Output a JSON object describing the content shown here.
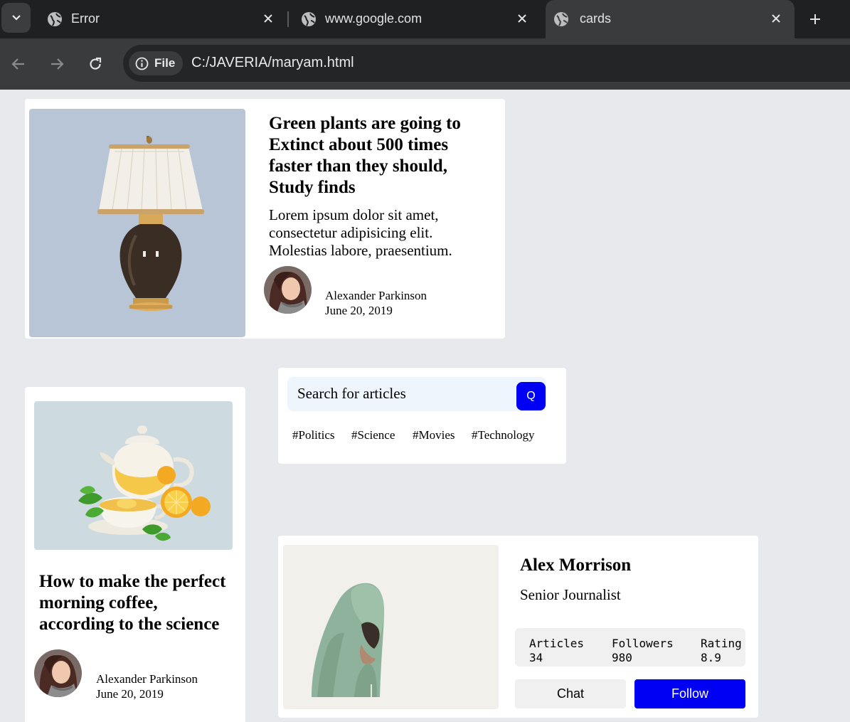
{
  "browser": {
    "tabs": [
      {
        "label": "Error",
        "active": false
      },
      {
        "label": "www.google.com",
        "active": false
      },
      {
        "label": "cards",
        "active": true
      }
    ],
    "address": {
      "chip": "File",
      "url": "C:/JAVERIA/maryam.html"
    }
  },
  "article_card": {
    "image": "table-lamp",
    "title": "Green plants are going to Extinct about 500 times faster than they should, Study finds",
    "body": "Lorem ipsum dolor sit amet, consectetur adipisicing elit. Molestias labore, praesentium.",
    "author": "Alexander Parkinson",
    "date": "June 20, 2019"
  },
  "coffee_card": {
    "image": "teapot-with-lemon-tea",
    "title": "How to make the perfect morning coffee, according to the science",
    "author": "Alexander Parkinson",
    "date": "June 20, 2019"
  },
  "search_card": {
    "placeholder": "Search for articles",
    "button_label": "Q",
    "tags": [
      "#Politics",
      "#Science",
      "#Movies",
      "#Technology"
    ]
  },
  "profile_card": {
    "image": "hooded-man",
    "name": "Alex Morrison",
    "role": "Senior Journalist",
    "stats": [
      {
        "label": "Articles",
        "value": "34"
      },
      {
        "label": "Followers",
        "value": "980"
      },
      {
        "label": "Rating",
        "value": "8.9"
      }
    ],
    "chat_label": "Chat",
    "follow_label": "Follow"
  },
  "colors": {
    "accent": "#0000f5",
    "page_bg": "#e8e9ec",
    "lamp_bg": "#b8c5d6",
    "teapot_bg": "#cddbe0",
    "profile_bg": "#f2f0eb"
  }
}
